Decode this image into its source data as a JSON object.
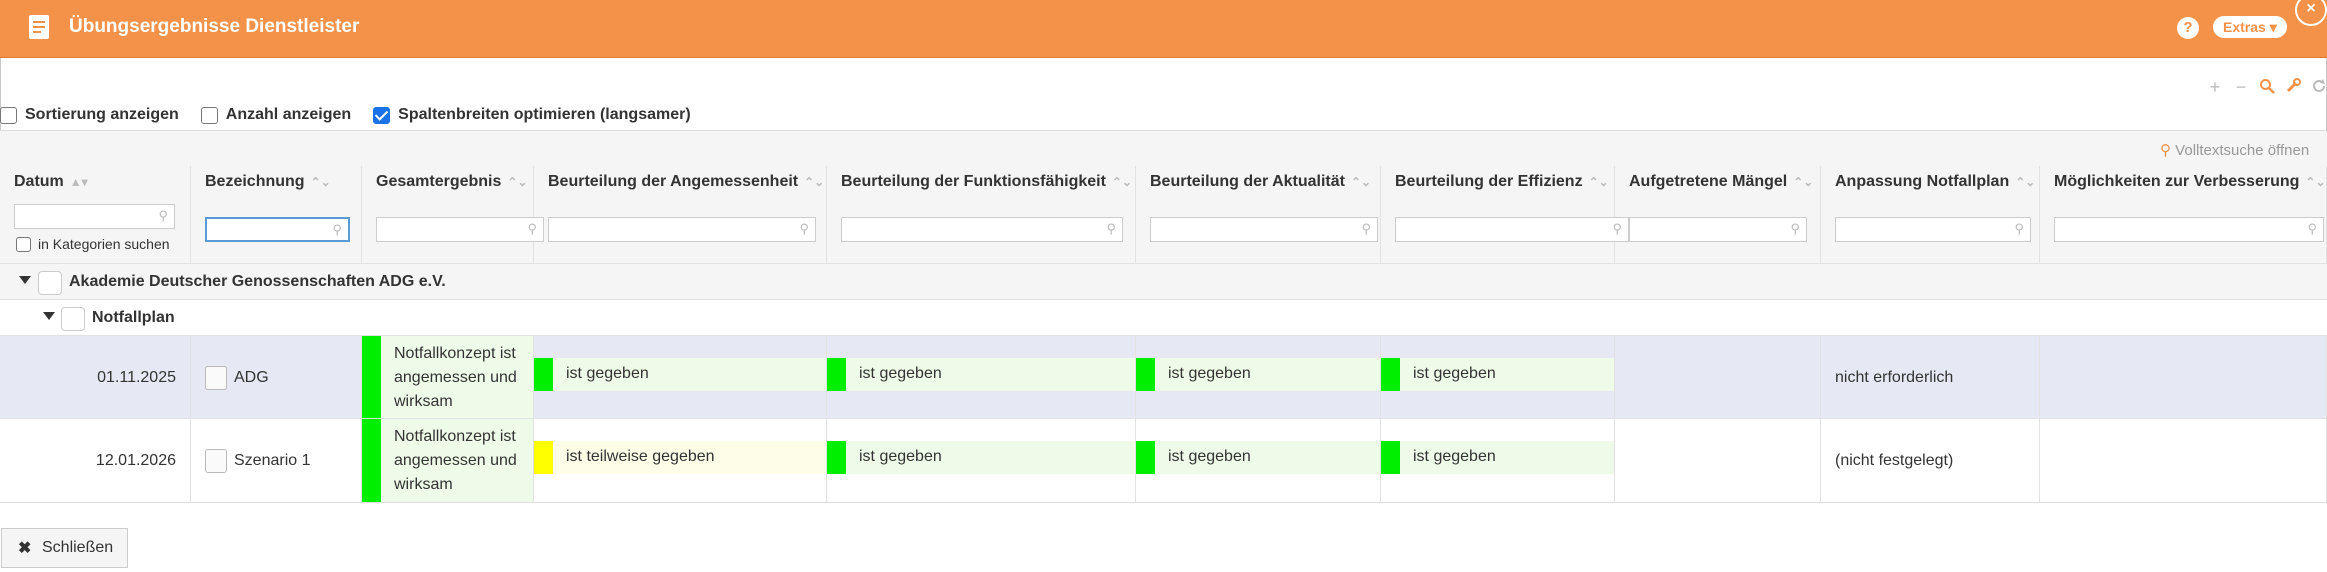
{
  "window": {
    "title": "Übungsergebnisse Dienstleister",
    "help_label": "?",
    "extras_label": "Extras ▾",
    "close_corner_label": "×"
  },
  "toolbar_icons": [
    "plus-icon",
    "minus-icon",
    "search-icon",
    "wrench-icon",
    "refresh-icon"
  ],
  "options": {
    "sort_label": "Sortierung anzeigen",
    "sort_checked": false,
    "count_label": "Anzahl anzeigen",
    "count_checked": false,
    "optimize_label": "Spaltenbreiten optimieren (langsamer)",
    "optimize_checked": true
  },
  "fulltext_label": "Volltextsuche öffnen",
  "columns": [
    {
      "label": "Datum",
      "sort": "▲▾"
    },
    {
      "label": "Bezeichnung",
      "sort": "⌃⌄"
    },
    {
      "label": "Gesamtergebnis",
      "sort": "⌃⌄"
    },
    {
      "label": "Beurteilung der Angemessenheit",
      "sort": "⌃⌄"
    },
    {
      "label": "Beurteilung der Funktionsfähigkeit",
      "sort": "⌃⌄"
    },
    {
      "label": "Beurteilung der Aktualität",
      "sort": "⌃⌄"
    },
    {
      "label": "Beurteilung der Effizienz",
      "sort": "⌃⌄"
    },
    {
      "label": "Aufgetretene Mängel",
      "sort": "⌃⌄"
    },
    {
      "label": "Anpassung Notfallplan",
      "sort": "⌃⌄"
    },
    {
      "label": "Möglichkeiten zur Verbesserung",
      "sort": "⌃⌄"
    }
  ],
  "in_categories_label": "in Kategorien suchen",
  "groups": {
    "level1": "Akademie Deutscher Genossenschaften ADG e.V.",
    "level2": "Notfallplan"
  },
  "rows": [
    {
      "date": "01.11.2025",
      "name": "ADG",
      "overall": "Notfallkonzept ist angemessen und wirksam",
      "angemessenheit": "ist gegeben",
      "funktion": "ist gegeben",
      "aktualitaet": "ist gegeben",
      "effizienz": "ist gegeben",
      "maengel": "",
      "anpassung": "nicht erforderlich",
      "verbesserung": ""
    },
    {
      "date": "12.01.2026",
      "name": "Szenario 1",
      "overall": "Notfallkonzept ist angemessen und wirksam",
      "angemessenheit": "ist teilweise gegeben",
      "funktion": "ist gegeben",
      "aktualitaet": "ist gegeben",
      "effizienz": "ist gegeben",
      "maengel": "",
      "anpassung": "(nicht festgelegt)",
      "verbesserung": ""
    }
  ],
  "colors": {
    "header_orange": "#f5924a",
    "rating_green": "#00ee00",
    "rating_yellow": "#ffff00",
    "rating_green_bg": "#eefbe8",
    "rating_yellow_bg": "#fdfde8",
    "selected_row_bg": "#e6e9f3"
  },
  "close_button_label": "Schließen"
}
